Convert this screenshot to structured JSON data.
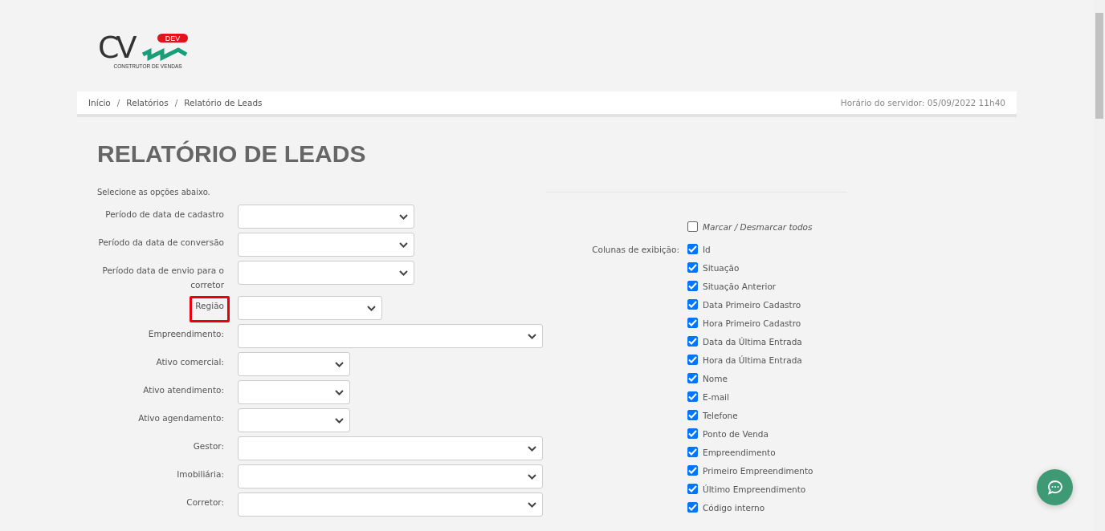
{
  "logo": {
    "mark": "CV",
    "badge": "DEV",
    "tagline": "CONSTRUTOR DE VENDAS"
  },
  "breadcrumb": [
    "Início",
    "Relatórios",
    "Relatório de Leads"
  ],
  "breadcrumb_separator": "/",
  "server_time": "Horário do servidor: 05/09/2022 11h40",
  "title": "RELATÓRIO DE LEADS",
  "intro": "Selecione as opções abaixo.",
  "fields": [
    {
      "label": "Período de data de cadastro",
      "kind": "medium",
      "highlighted": false
    },
    {
      "label": "Período da data de conversão",
      "kind": "medium",
      "highlighted": false
    },
    {
      "label": "Período data de envio para o corretor",
      "kind": "medium",
      "highlighted": false
    },
    {
      "label": "Região",
      "kind": "short",
      "highlighted": true
    },
    {
      "label": "Empreendimento:",
      "kind": "long",
      "highlighted": false
    },
    {
      "label": "Ativo comercial:",
      "kind": "tiny",
      "highlighted": false
    },
    {
      "label": "Ativo atendimento:",
      "kind": "tiny",
      "highlighted": false
    },
    {
      "label": "Ativo agendamento:",
      "kind": "tiny",
      "highlighted": false
    },
    {
      "label": "Gestor:",
      "kind": "long",
      "highlighted": false
    },
    {
      "label": "Imobiliária:",
      "kind": "long",
      "highlighted": false
    },
    {
      "label": "Corretor:",
      "kind": "long",
      "highlighted": false
    }
  ],
  "toggle_all": {
    "label": "Marcar / Desmarcar todos",
    "checked": false
  },
  "columns_label": "Colunas de exibição:",
  "columns": [
    {
      "label": "Id",
      "checked": true
    },
    {
      "label": "Situação",
      "checked": true
    },
    {
      "label": "Situação Anterior",
      "checked": true
    },
    {
      "label": "Data Primeiro Cadastro",
      "checked": true
    },
    {
      "label": "Hora Primeiro Cadastro",
      "checked": true
    },
    {
      "label": "Data da Última Entrada",
      "checked": true
    },
    {
      "label": "Hora da Última Entrada",
      "checked": true
    },
    {
      "label": "Nome",
      "checked": true
    },
    {
      "label": "E-mail",
      "checked": true
    },
    {
      "label": "Telefone",
      "checked": true
    },
    {
      "label": "Ponto de Venda",
      "checked": true
    },
    {
      "label": "Empreendimento",
      "checked": true
    },
    {
      "label": "Primeiro Empreendimento",
      "checked": true
    },
    {
      "label": "Último Empreendimento",
      "checked": true
    },
    {
      "label": "Código interno",
      "checked": true
    }
  ]
}
